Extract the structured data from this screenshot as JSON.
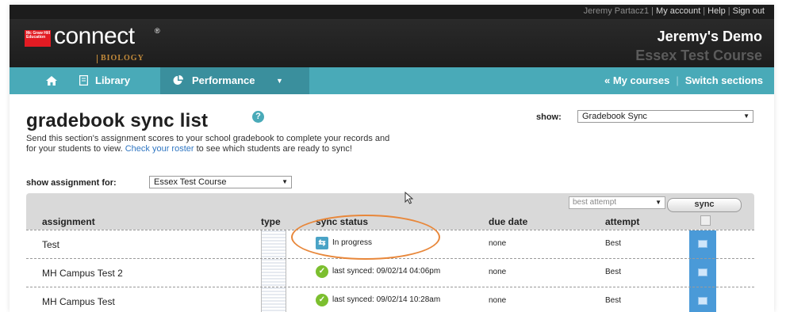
{
  "topbar": {
    "user": "Jeremy Partacz1",
    "links": [
      "My account",
      "Help",
      "Sign out"
    ]
  },
  "header": {
    "logo_text": "connect",
    "logo_tm": "®",
    "logo_mini": "Mc Graw Hill Education",
    "logo_subject": "BIOLOGY",
    "user_title": "Jeremy's Demo",
    "course_title": "Essex Test Course"
  },
  "nav": {
    "home_icon": "home-icon",
    "library_label": "Library",
    "performance_label": "Performance",
    "my_courses": "« My courses",
    "switch_sections": "Switch sections"
  },
  "page": {
    "title": "gradebook sync list",
    "help_glyph": "?",
    "description_1": "Send this section's assignment scores to your school gradebook to complete your records and",
    "description_2a": "for your students to view. ",
    "description_link": "Check your roster",
    "description_2b": " to see which students are ready to sync!",
    "show_label": "show:",
    "show_value": "Gradebook Sync",
    "assignment_label": "show assignment for:",
    "assignment_value": "Essex Test Course"
  },
  "grid": {
    "attempt_select": "best attempt",
    "sync_button": "sync",
    "headers": {
      "assignment": "assignment",
      "type": "type",
      "sync_status": "sync status",
      "due_date": "due date",
      "attempt": "attempt"
    },
    "rows": [
      {
        "name": "Test",
        "status": "In progress",
        "status_kind": "progress",
        "due": "none",
        "attempt": "Best"
      },
      {
        "name": "MH Campus Test 2",
        "status": "last synced: 09/02/14 04:06pm",
        "status_kind": "synced",
        "due": "none",
        "attempt": "Best"
      },
      {
        "name": "MH Campus Test",
        "status": "last synced: 09/02/14 10:28am",
        "status_kind": "synced",
        "due": "none",
        "attempt": "Best"
      }
    ]
  },
  "colors": {
    "nav_bg": "#49aab8",
    "nav_active": "#3a8f9d",
    "brand_red": "#e31b23",
    "highlight_orange": "#e8873a",
    "check_column": "#4a9ad8"
  }
}
